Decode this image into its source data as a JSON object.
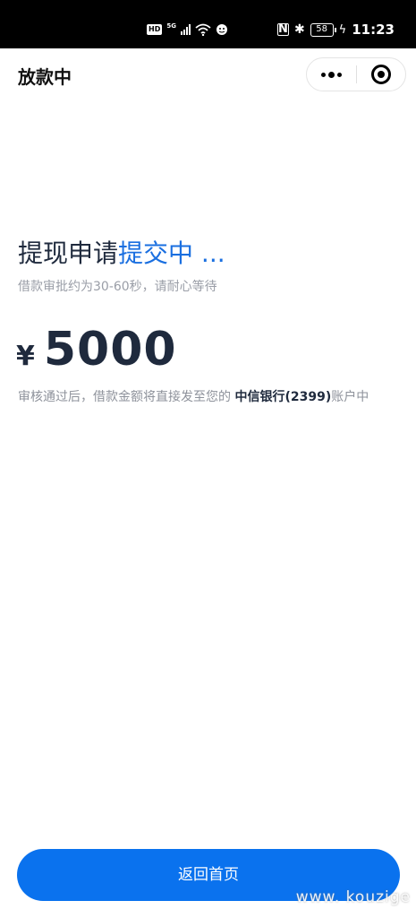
{
  "status_bar": {
    "hd": "HD",
    "network": "5G",
    "battery": "58",
    "nfc": "N",
    "bluetooth": "✱",
    "charging": "ϟ",
    "time": "11:23"
  },
  "nav": {
    "title": "放款中"
  },
  "content": {
    "heading_prefix": "提现申请",
    "heading_accent": "提交中 ...",
    "subtext": "借款审批约为30-60秒，请耐心等待",
    "currency": "¥",
    "amount": "5000",
    "notice_prefix": "审核通过后，借款金额将直接发至您的 ",
    "notice_bank": "中信银行(2399)",
    "notice_suffix": "账户中"
  },
  "button": {
    "home_label": "返回首页"
  },
  "watermark": "www. kouzige",
  "colors": {
    "accent": "#1a6fe0",
    "button": "#0a72ee",
    "text_dark": "#1f2a3d",
    "text_muted": "#9a9ea7"
  }
}
